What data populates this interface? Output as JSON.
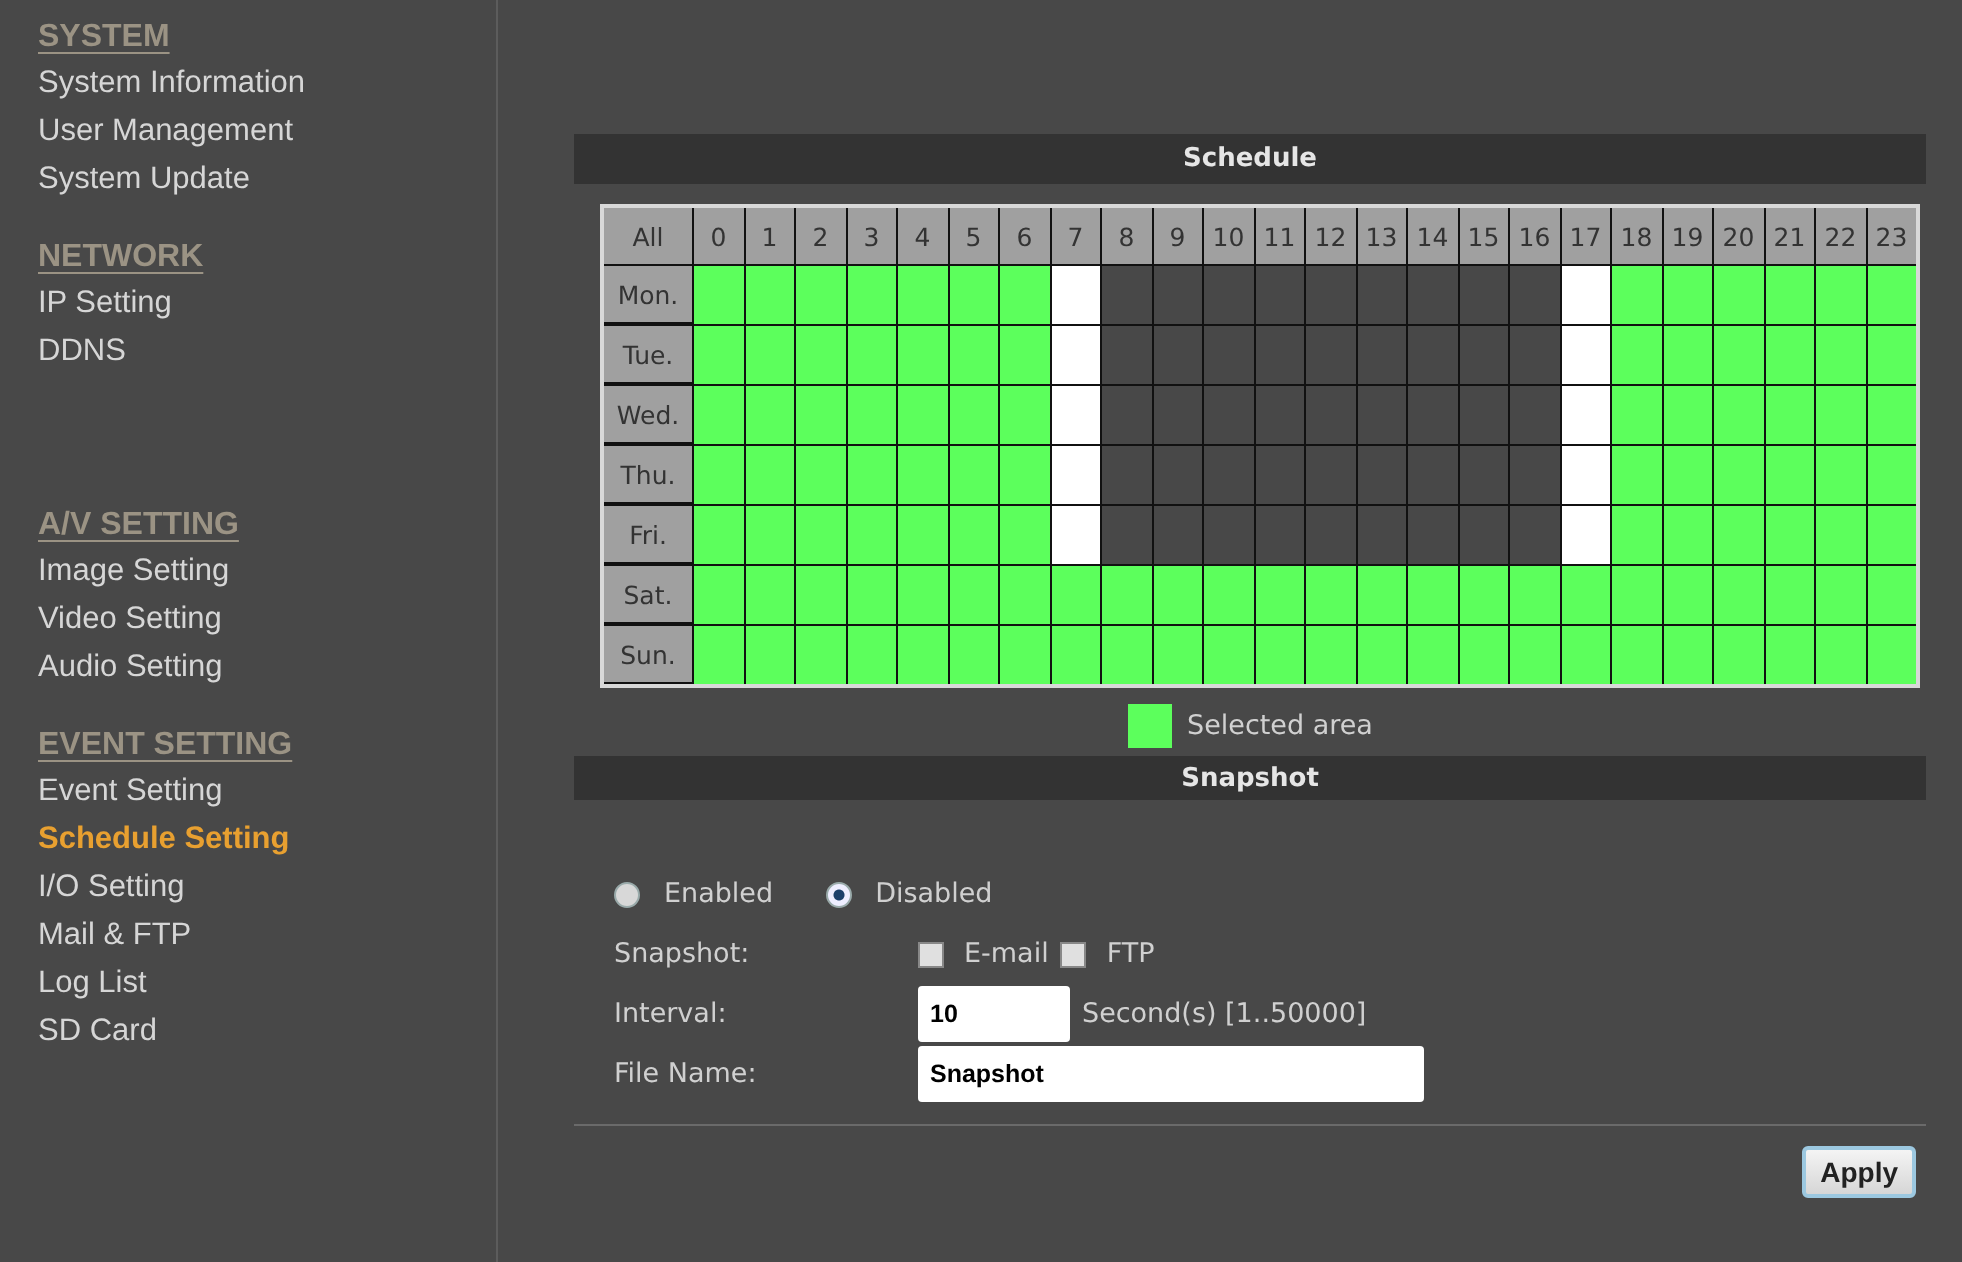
{
  "sidebar": {
    "sections": [
      {
        "heading": "SYSTEM",
        "items": [
          {
            "label": "System Information",
            "selected": false
          },
          {
            "label": "User Management",
            "selected": false
          },
          {
            "label": "System Update",
            "selected": false
          }
        ]
      },
      {
        "heading": "NETWORK",
        "items": [
          {
            "label": "IP Setting",
            "selected": false
          },
          {
            "label": "DDNS",
            "selected": false
          }
        ]
      },
      {
        "heading": "A/V SETTING",
        "items": [
          {
            "label": "Image Setting",
            "selected": false
          },
          {
            "label": "Video Setting",
            "selected": false
          },
          {
            "label": "Audio Setting",
            "selected": false
          }
        ]
      },
      {
        "heading": "EVENT SETTING",
        "items": [
          {
            "label": "Event Setting",
            "selected": false
          },
          {
            "label": "Schedule Setting",
            "selected": true
          },
          {
            "label": "I/O Setting",
            "selected": false
          },
          {
            "label": "Mail & FTP",
            "selected": false
          },
          {
            "label": "Log List",
            "selected": false
          },
          {
            "label": "SD Card",
            "selected": false
          }
        ]
      }
    ]
  },
  "schedule": {
    "title": "Schedule",
    "all_label": "All",
    "hours": [
      "0",
      "1",
      "2",
      "3",
      "4",
      "5",
      "6",
      "7",
      "8",
      "9",
      "10",
      "11",
      "12",
      "13",
      "14",
      "15",
      "16",
      "17",
      "18",
      "19",
      "20",
      "21",
      "22",
      "23"
    ],
    "rows": [
      {
        "day": "Mon.",
        "selected": [
          true,
          true,
          true,
          true,
          true,
          true,
          true,
          false,
          false,
          false,
          false,
          false,
          false,
          false,
          false,
          false,
          false,
          false,
          true,
          true,
          true,
          true,
          true,
          true
        ],
        "highlighted": [
          false,
          false,
          false,
          false,
          false,
          false,
          false,
          true,
          false,
          false,
          false,
          false,
          false,
          false,
          false,
          false,
          false,
          true,
          false,
          false,
          false,
          false,
          false,
          false
        ]
      },
      {
        "day": "Tue.",
        "selected": [
          true,
          true,
          true,
          true,
          true,
          true,
          true,
          false,
          false,
          false,
          false,
          false,
          false,
          false,
          false,
          false,
          false,
          false,
          true,
          true,
          true,
          true,
          true,
          true
        ],
        "highlighted": [
          false,
          false,
          false,
          false,
          false,
          false,
          false,
          true,
          false,
          false,
          false,
          false,
          false,
          false,
          false,
          false,
          false,
          true,
          false,
          false,
          false,
          false,
          false,
          false
        ]
      },
      {
        "day": "Wed.",
        "selected": [
          true,
          true,
          true,
          true,
          true,
          true,
          true,
          false,
          false,
          false,
          false,
          false,
          false,
          false,
          false,
          false,
          false,
          false,
          true,
          true,
          true,
          true,
          true,
          true
        ],
        "highlighted": [
          false,
          false,
          false,
          false,
          false,
          false,
          false,
          true,
          false,
          false,
          false,
          false,
          false,
          false,
          false,
          false,
          false,
          true,
          false,
          false,
          false,
          false,
          false,
          false
        ]
      },
      {
        "day": "Thu.",
        "selected": [
          true,
          true,
          true,
          true,
          true,
          true,
          true,
          false,
          false,
          false,
          false,
          false,
          false,
          false,
          false,
          false,
          false,
          false,
          true,
          true,
          true,
          true,
          true,
          true
        ],
        "highlighted": [
          false,
          false,
          false,
          false,
          false,
          false,
          false,
          true,
          false,
          false,
          false,
          false,
          false,
          false,
          false,
          false,
          false,
          true,
          false,
          false,
          false,
          false,
          false,
          false
        ]
      },
      {
        "day": "Fri.",
        "selected": [
          true,
          true,
          true,
          true,
          true,
          true,
          true,
          false,
          false,
          false,
          false,
          false,
          false,
          false,
          false,
          false,
          false,
          false,
          true,
          true,
          true,
          true,
          true,
          true
        ],
        "highlighted": [
          false,
          false,
          false,
          false,
          false,
          false,
          false,
          true,
          false,
          false,
          false,
          false,
          false,
          false,
          false,
          false,
          false,
          true,
          false,
          false,
          false,
          false,
          false,
          false
        ]
      },
      {
        "day": "Sat.",
        "selected": [
          true,
          true,
          true,
          true,
          true,
          true,
          true,
          true,
          true,
          true,
          true,
          true,
          true,
          true,
          true,
          true,
          true,
          true,
          true,
          true,
          true,
          true,
          true,
          true
        ],
        "highlighted": [
          false,
          false,
          false,
          false,
          false,
          false,
          false,
          false,
          false,
          false,
          false,
          false,
          false,
          false,
          false,
          false,
          false,
          false,
          false,
          false,
          false,
          false,
          false,
          false
        ]
      },
      {
        "day": "Sun.",
        "selected": [
          true,
          true,
          true,
          true,
          true,
          true,
          true,
          true,
          true,
          true,
          true,
          true,
          true,
          true,
          true,
          true,
          true,
          true,
          true,
          true,
          true,
          true,
          true,
          true
        ],
        "highlighted": [
          false,
          false,
          false,
          false,
          false,
          false,
          false,
          false,
          false,
          false,
          false,
          false,
          false,
          false,
          false,
          false,
          false,
          false,
          false,
          false,
          false,
          false,
          false,
          false
        ]
      }
    ],
    "legend": "Selected area"
  },
  "snapshot": {
    "title": "Snapshot",
    "modes": [
      {
        "label": "Enabled",
        "selected": false
      },
      {
        "label": "Disabled",
        "selected": true
      }
    ],
    "targets_label": "Snapshot:",
    "targets": [
      {
        "label": "E-mail",
        "checked": false
      },
      {
        "label": "FTP",
        "checked": false
      }
    ],
    "interval_label": "Interval:",
    "interval": "10",
    "interval_hint": "Second(s) [1..50000]",
    "file_name_label": "File Name:",
    "file_name": "Snapshot"
  },
  "apply_button": "Apply"
}
